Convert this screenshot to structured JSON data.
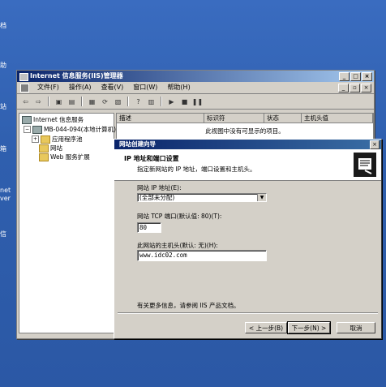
{
  "desktop": {
    "labels": [
      "档",
      "助",
      "站",
      "箱",
      "net",
      "ver",
      "信"
    ]
  },
  "iis_window": {
    "title": "Internet 信息服务(IIS)管理器",
    "menus": [
      "文件(F)",
      "操作(A)",
      "查看(V)",
      "窗口(W)",
      "帮助(H)"
    ],
    "tree": {
      "root": "Internet 信息服务",
      "server": "MB-044-094(本地计算机)",
      "children": [
        "应用程序池",
        "网站",
        "Web 服务扩展"
      ]
    },
    "columns": [
      "描述",
      "标识符",
      "状态",
      "主机头值"
    ],
    "empty_message": "此视图中没有可显示的项目。"
  },
  "wizard": {
    "title": "网站创建向导",
    "heading": "IP 地址和端口设置",
    "subheading": "指定新网站的 IP 地址，端口设置和主机头。",
    "ip_label": "网站 IP 地址(E):",
    "ip_value": "(全部未分配)",
    "port_label": "网站 TCP 端口(默认值: 80)(T):",
    "port_value": "80",
    "host_label": "此网站的主机头(默认: 无)(H):",
    "host_value": "www.idc02.com",
    "info_text": "有关更多信息，请参阅 IIS 产品文档。",
    "back_label": "< 上一步(B)",
    "next_label": "下一步(N) >",
    "cancel_label": "取消"
  }
}
